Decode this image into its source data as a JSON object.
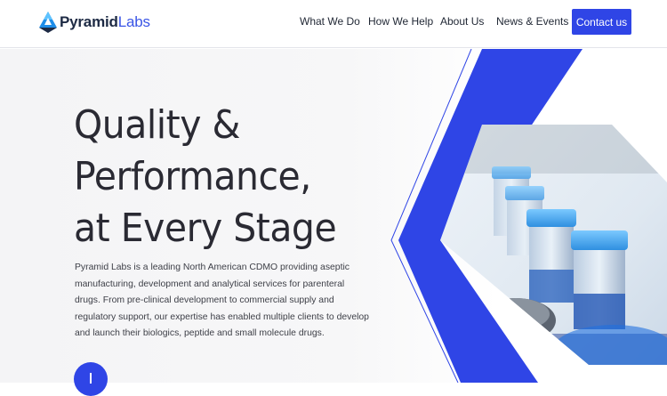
{
  "brand": {
    "name_bold": "Pyramid",
    "name_light": "Labs"
  },
  "nav": {
    "items": [
      "What We Do",
      "How We Help",
      "About Us",
      "News & Events"
    ],
    "contact_label": "Contact us"
  },
  "hero": {
    "headline_lines": [
      "Quality &",
      "Performance,",
      "at Every Stage"
    ],
    "description": "Pyramid Labs is a leading North American CDMO providing aseptic manufacturing, development and analytical services for parenteral drugs. From pre-clinical development to commercial supply and regulatory support, our expertise has enabled multiple clients to develop and launch their biologics, peptide and small molecule drugs.",
    "image_subject": "vials-on-production-line"
  },
  "colors": {
    "accent": "#2f45e6",
    "text": "#2a2a33"
  }
}
